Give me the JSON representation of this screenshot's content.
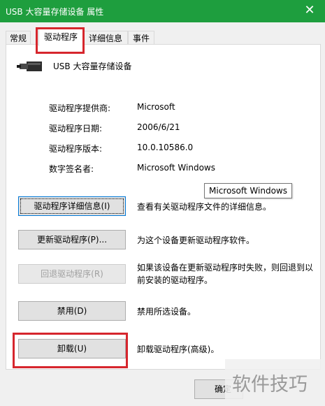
{
  "window": {
    "title": "USB 大容量存储设备 属性",
    "close_label": "✕"
  },
  "tabs": [
    {
      "label": "常规"
    },
    {
      "label": "驱动程序"
    },
    {
      "label": "详细信息"
    },
    {
      "label": "事件"
    }
  ],
  "device": {
    "icon": "usb-connector-icon",
    "name": "USB 大容量存储设备"
  },
  "info": [
    {
      "label": "驱动程序提供商:",
      "value": "Microsoft"
    },
    {
      "label": "驱动程序日期:",
      "value": "2006/6/21"
    },
    {
      "label": "驱动程序版本:",
      "value": "10.0.10586.0"
    },
    {
      "label": "数字签名者:",
      "value": "Microsoft Windows"
    }
  ],
  "tooltip": "Microsoft Windows",
  "actions": [
    {
      "button": "驱动程序详细信息(I)",
      "description": "查看有关驱动程序文件的详细信息。"
    },
    {
      "button": "更新驱动程序(P)...",
      "description": "为这个设备更新驱动程序软件。"
    },
    {
      "button": "回退驱动程序(R)",
      "description": "如果该设备在更新驱动程序时失败，则回退到以前安装的驱动程序。"
    },
    {
      "button": "禁用(D)",
      "description": "禁用所选设备。"
    },
    {
      "button": "卸载(U)",
      "description": "卸载驱动程序(高级)。"
    }
  ],
  "footer": {
    "ok_label": "确定"
  },
  "watermark": "软件技巧",
  "colors": {
    "titlebar": "#1e9e3e",
    "highlight": "#d6262d",
    "focus": "#0078d7"
  }
}
